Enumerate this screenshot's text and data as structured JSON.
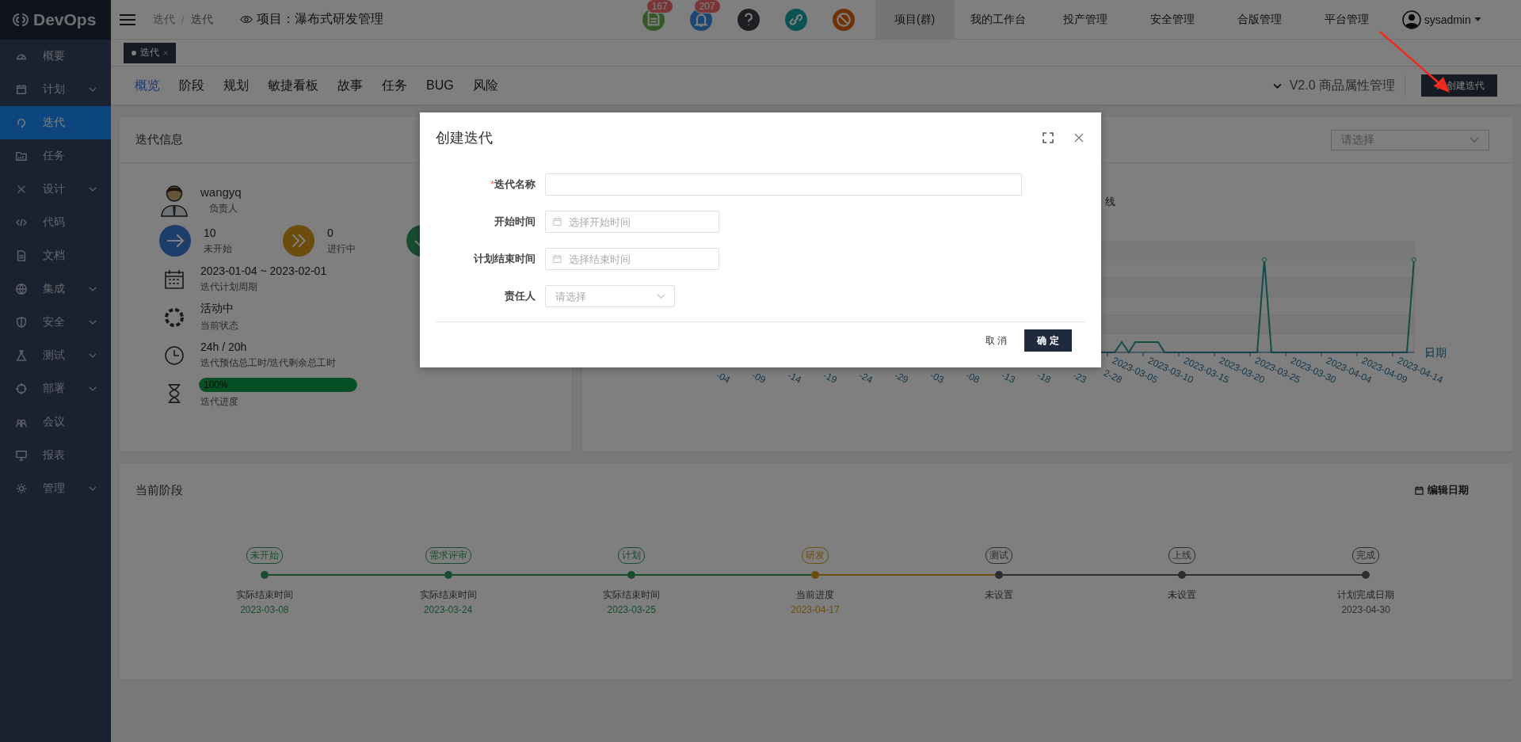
{
  "sidebar": {
    "logo": "DevOps",
    "items": [
      {
        "label": "概要",
        "kind": "link",
        "selected": false
      },
      {
        "label": "计划",
        "kind": "group",
        "selected": false
      },
      {
        "label": "迭代",
        "kind": "link",
        "selected": true
      },
      {
        "label": "任务",
        "kind": "link",
        "selected": false
      },
      {
        "label": "设计",
        "kind": "group",
        "selected": false
      },
      {
        "label": "代码",
        "kind": "link",
        "selected": false
      },
      {
        "label": "文档",
        "kind": "link",
        "selected": false
      },
      {
        "label": "集成",
        "kind": "group",
        "selected": false
      },
      {
        "label": "安全",
        "kind": "group",
        "selected": false
      },
      {
        "label": "测试",
        "kind": "group",
        "selected": false
      },
      {
        "label": "部署",
        "kind": "group",
        "selected": false
      },
      {
        "label": "会议",
        "kind": "link",
        "selected": false
      },
      {
        "label": "报表",
        "kind": "link",
        "selected": false
      },
      {
        "label": "管理",
        "kind": "group",
        "selected": false
      }
    ]
  },
  "header": {
    "breadcrumb": [
      "迭代",
      "迭代"
    ],
    "breadcrumb_separator": "/",
    "project": "项目：瀑布式研发管理",
    "notifications": [
      {
        "kind": "document",
        "badge": "167"
      },
      {
        "kind": "bell",
        "badge": "207"
      },
      {
        "kind": "help"
      },
      {
        "kind": "link"
      },
      {
        "kind": "block"
      }
    ],
    "nav": [
      {
        "label": "项目(群)",
        "selected": true
      },
      {
        "label": "我的工作台",
        "selected": false
      },
      {
        "label": "投产管理",
        "selected": false
      },
      {
        "label": "安全管理",
        "selected": false
      },
      {
        "label": "合版管理",
        "selected": false
      },
      {
        "label": "平台管理",
        "selected": false
      }
    ],
    "user": "sysadmin"
  },
  "tab_strip": [
    {
      "label": "迭代",
      "selected": true
    }
  ],
  "page_tabs": [
    {
      "label": "概览",
      "selected": true
    },
    {
      "label": "阶段",
      "selected": false
    },
    {
      "label": "规划",
      "selected": false
    },
    {
      "label": "敏捷看板",
      "selected": false
    },
    {
      "label": "故事",
      "selected": false
    },
    {
      "label": "任务",
      "selected": false
    },
    {
      "label": "BUG",
      "selected": false
    },
    {
      "label": "风险",
      "selected": false
    }
  ],
  "iteration_picker": "V2.0 商品属性管理",
  "create_button": "创建迭代",
  "info_card": {
    "title": "迭代信息",
    "owner": {
      "name": "wangyq",
      "role": "负责人"
    },
    "stats": [
      {
        "kind": "not_started",
        "count": "10",
        "label": "未开始"
      },
      {
        "kind": "in_progress",
        "count": "0",
        "label": "进行中"
      },
      {
        "kind": "done"
      }
    ],
    "period": {
      "value": "2023-01-04 ~ 2023-02-01",
      "caption": "迭代计划周期"
    },
    "status": {
      "value": "活动中",
      "caption": "当前状态"
    },
    "hours": {
      "value": "24h / 20h",
      "caption": "迭代预估总工时/迭代剩余总工时"
    },
    "progress": {
      "level": 1.0,
      "reading": "100%",
      "caption": "迭代进度"
    }
  },
  "trend_card": {
    "select_placeholder": "请选择",
    "title_fragment": "线",
    "x_axis_name": "日期",
    "x_labels": [
      "-04",
      "-09",
      "-14",
      "-19",
      "-24",
      "-29",
      "-03",
      "-08",
      "-13",
      "-18",
      "-23",
      "2-28",
      "2023-03-05",
      "2023-03-10",
      "2023-03-15",
      "2023-03-20",
      "2023-03-25",
      "2023-03-30",
      "2023-04-04",
      "2023-04-09",
      "2023-04-14"
    ]
  },
  "stages_card": {
    "title": "当前阶段",
    "edit_button": "编辑日期",
    "stages": [
      {
        "name": "未开始",
        "color": "#174d2f",
        "caption": "实际结束时间",
        "date": "2023-03-08"
      },
      {
        "name": "需求评审",
        "color": "#174d2f",
        "caption": "实际结束时间",
        "date": "2023-03-24"
      },
      {
        "name": "计划",
        "color": "#174d2f",
        "caption": "实际结束时间",
        "date": "2023-03-25"
      },
      {
        "name": "研发",
        "color": "#6d4d0e",
        "caption": "当前进度",
        "date": "2023-04-17"
      },
      {
        "name": "测试",
        "color": "#2b2d30",
        "caption": "未设置"
      },
      {
        "name": "上线",
        "color": "#2b2d30",
        "caption": "未设置"
      },
      {
        "name": "完成",
        "color": "#2b2d30",
        "caption": "计划完成日期",
        "date": "2023-04-30"
      }
    ]
  },
  "dialog": {
    "title": "创建迭代",
    "required_mark": "*",
    "fields": [
      {
        "label": "迭代名称",
        "kind": "text",
        "required": true
      },
      {
        "label": "开始时间",
        "kind": "date",
        "required": false,
        "placeholder": "选择开始时间"
      },
      {
        "label": "计划结束时间",
        "kind": "date",
        "required": false,
        "placeholder": "选择结束时间"
      },
      {
        "label": "责任人",
        "kind": "select",
        "required": false,
        "placeholder": "请选择"
      }
    ],
    "cancel": "取 消",
    "confirm": "确 定"
  }
}
